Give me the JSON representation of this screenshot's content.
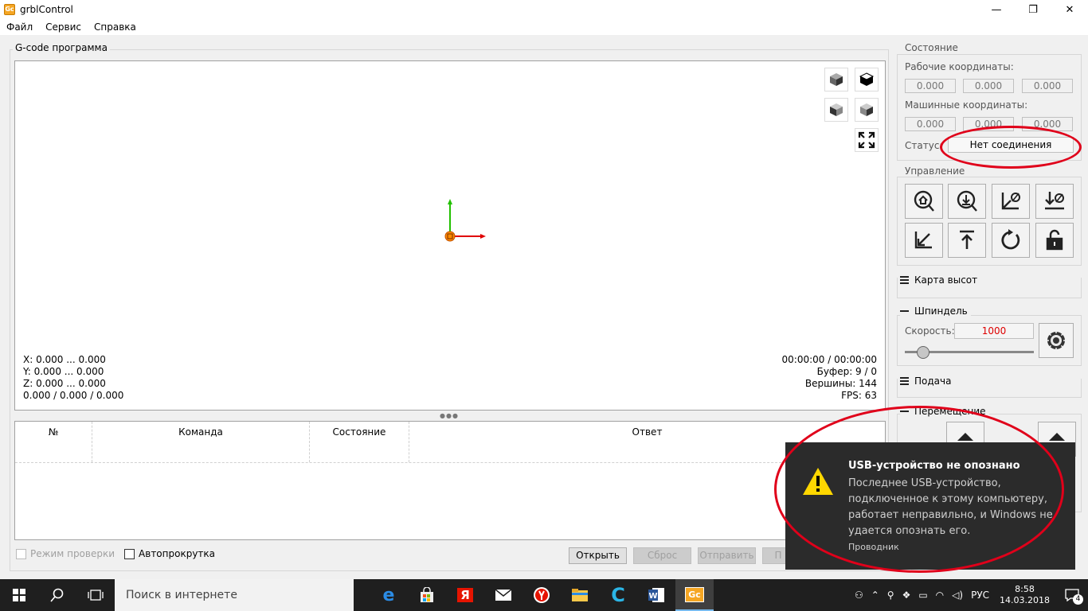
{
  "window": {
    "title": "grblControl",
    "minimize": "—",
    "maximize": "❐",
    "close": "✕"
  },
  "menu": [
    "Файл",
    "Сервис",
    "Справка"
  ],
  "gcode": {
    "group_title": "G-code программа",
    "info_left": [
      "X: 0.000 ... 0.000",
      "Y: 0.000 ... 0.000",
      "Z: 0.000 ... 0.000",
      "0.000 / 0.000 / 0.000"
    ],
    "info_right": [
      "00:00:00 / 00:00:00",
      "Буфер: 9 / 0",
      "Вершины: 144",
      "FPS: 63"
    ],
    "table_headers": [
      "№",
      "Команда",
      "Состояние",
      "Ответ"
    ],
    "check_mode": "Режим проверки",
    "autoscroll": "Автопрокрутка",
    "open_btn": "Открыть",
    "reset_btn": "Сброс",
    "send_btn": "Отправить",
    "partial_btn": "П"
  },
  "state": {
    "group_title": "Состояние",
    "work_label": "Рабочие координаты:",
    "work": [
      "0.000",
      "0.000",
      "0.000"
    ],
    "machine_label": "Машинные координаты:",
    "machine": [
      "0.000",
      "0.000",
      "0.000"
    ],
    "status_label": "Статус:",
    "status_value": "Нет соединения"
  },
  "control": {
    "group_title": "Управление"
  },
  "heightmap": {
    "title": "Карта высот"
  },
  "spindle": {
    "title": "Шпиндель",
    "speed_label": "Скорость:",
    "speed_value": "1000",
    "slider_fraction": 0.14
  },
  "feed": {
    "title": "Подача"
  },
  "movement": {
    "title": "Перемещение"
  },
  "toast": {
    "title": "USB-устройство не опознано",
    "body": "Последнее USB-устройство, подключенное к этому компьютеру, работает неправильно, и Windows не удается опознать его.",
    "source": "Проводник"
  },
  "taskbar": {
    "search_placeholder": "Поиск в интернете",
    "lang": "РУС",
    "time": "8:58",
    "date": "14.03.2018",
    "notif_count": "4"
  },
  "colors": {
    "accent_red": "#e0001a",
    "toast_bg": "#2b2b2b",
    "speed_red": "#dd0000"
  }
}
